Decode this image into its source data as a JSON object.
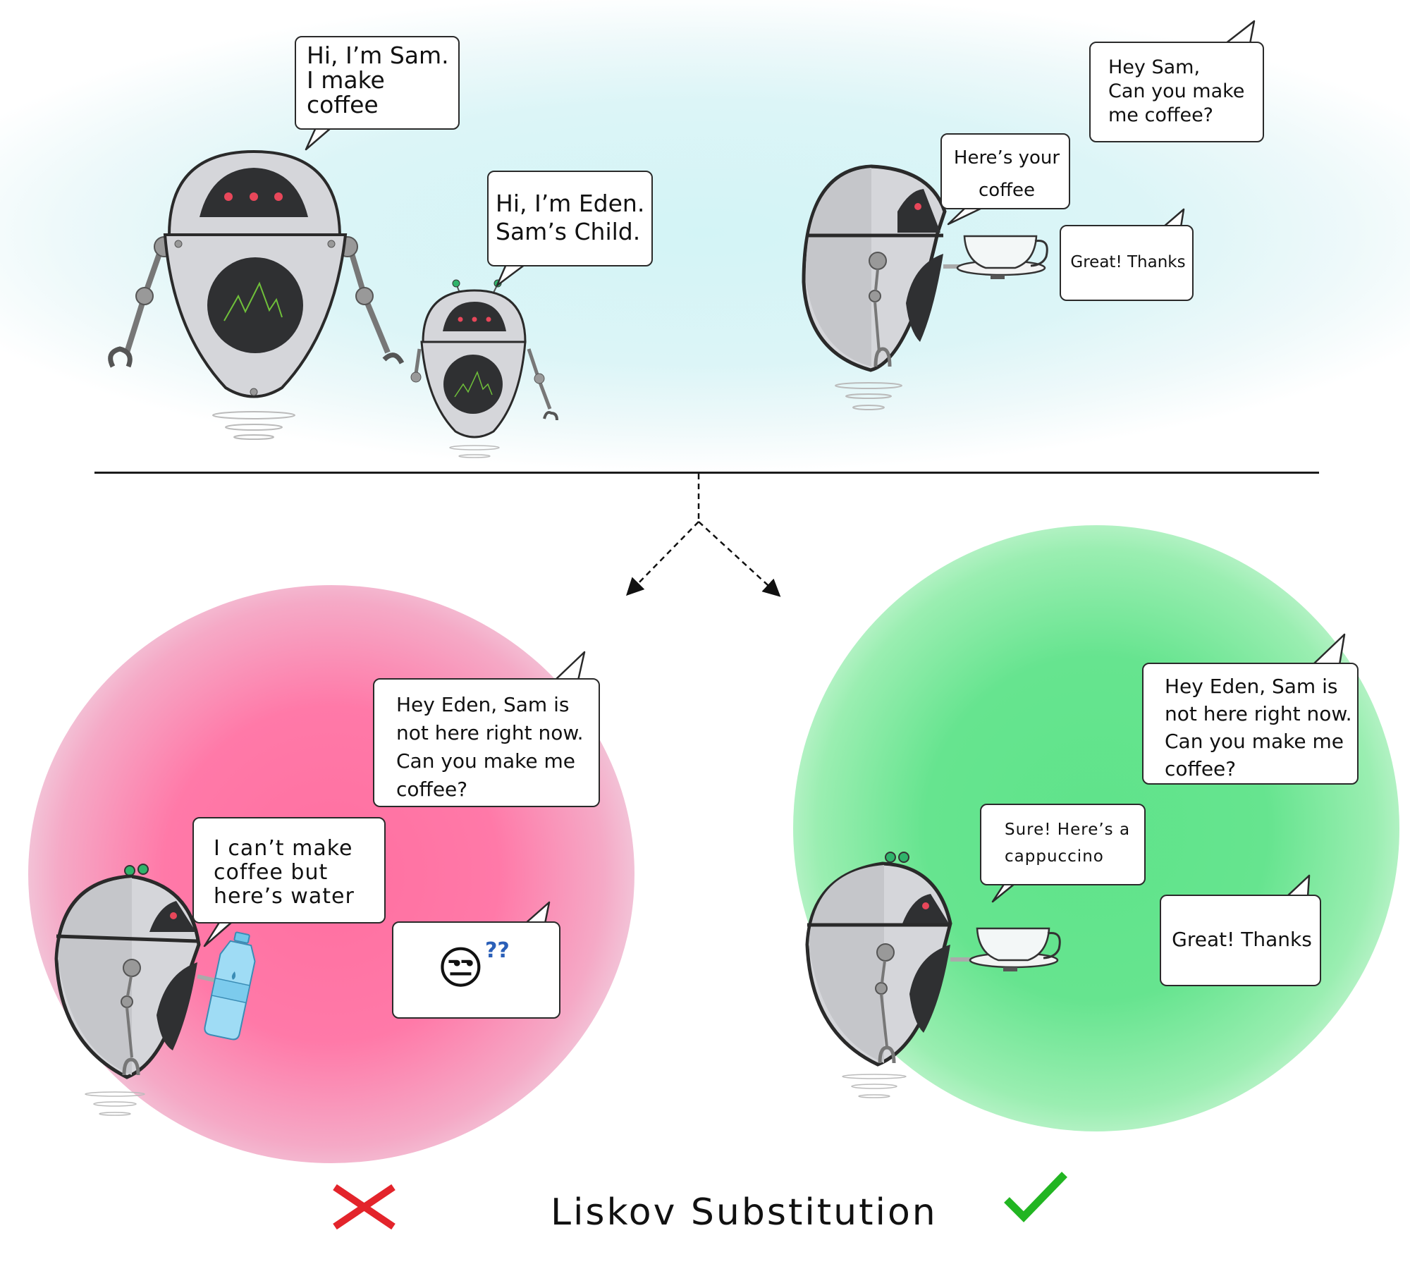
{
  "title": "Liskov Substitution",
  "colors": {
    "sky": "#d7f5f7",
    "bad_blob": "#ff6fa0",
    "good_blob": "#5fe38a",
    "cross": "#e3242b",
    "check": "#22b522",
    "robot_body": "#d3d4d8",
    "robot_dark": "#2f3032",
    "eye": "#e8475a",
    "antenna": "#2fb36a"
  },
  "top_scene": {
    "left": {
      "parent_bubble": "Hi, I’m Sam.\nI make\ncoffee",
      "child_bubble": "Hi, I’m Eden.\nSam’s Child.",
      "parent_name": "Sam",
      "child_name": "Eden"
    },
    "right": {
      "request_bubble": "Hey Sam,\nCan you make\nme coffee?",
      "robot_bubble": "Here’s your\ncoffee",
      "reply_bubble": "Great! Thanks",
      "item": "coffee-cup"
    }
  },
  "bottom_left": {
    "verdict": "cross",
    "request_bubble": "Hey Eden, Sam is\nnot here right now.\nCan you make me\ncoffee?",
    "robot_bubble": "I can’t make\ncoffee but\nhere’s water",
    "reaction_emoji": "😒",
    "reaction_marks": "??",
    "item": "water-bottle"
  },
  "bottom_right": {
    "verdict": "check",
    "request_bubble": "Hey Eden, Sam is\nnot here right now.\nCan you make me\ncoffee?",
    "robot_bubble": "Sure! Here’s a\ncappuccino",
    "reply_bubble": "Great! Thanks",
    "item": "coffee-cup"
  }
}
